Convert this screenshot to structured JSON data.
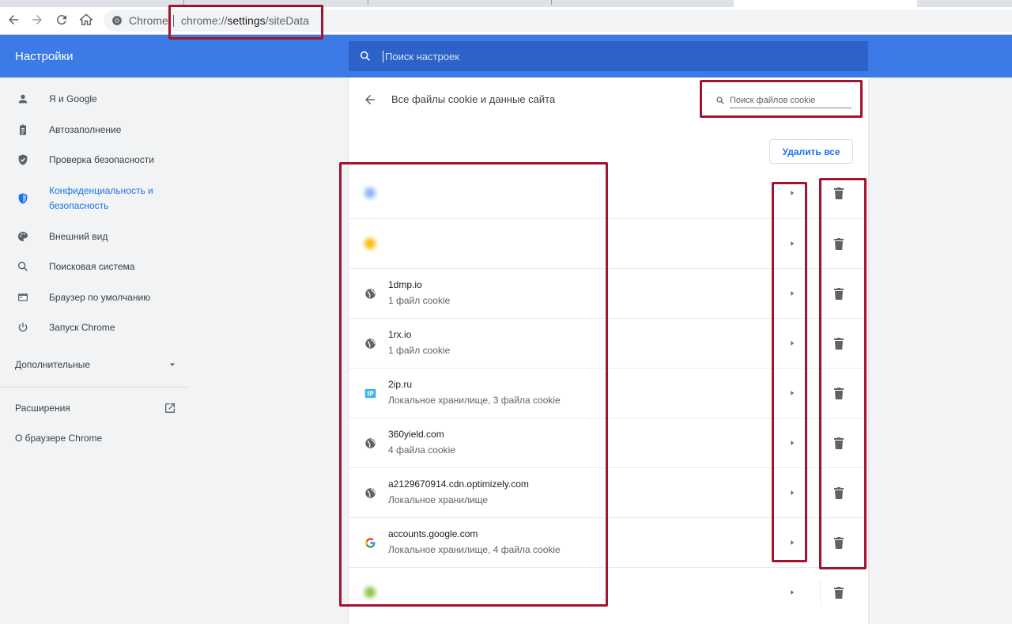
{
  "browser": {
    "chip_label": "Chrome",
    "url_prefix": "chrome://",
    "url_host": "settings",
    "url_path": "/siteData"
  },
  "header": {
    "title": "Настройки",
    "search_placeholder": "Поиск настроек"
  },
  "sidebar": {
    "items": [
      {
        "label": "Я и Google",
        "icon": "person-icon"
      },
      {
        "label": "Автозаполнение",
        "icon": "clipboard-icon"
      },
      {
        "label": "Проверка безопасности",
        "icon": "shield-check-icon"
      },
      {
        "label": "Конфиденциальность и безопасность",
        "label_line1": "Конфиденциальность и",
        "label_line2": "безопасность",
        "icon": "privacy-shield-icon",
        "active": true
      },
      {
        "label": "Внешний вид",
        "icon": "palette-icon"
      },
      {
        "label": "Поисковая система",
        "icon": "search-icon"
      },
      {
        "label": "Браузер по умолчанию",
        "icon": "browser-window-icon"
      },
      {
        "label": "Запуск Chrome",
        "icon": "power-icon"
      }
    ],
    "advanced": "Дополнительные",
    "extensions": "Расширения",
    "about": "О браузере Chrome"
  },
  "page": {
    "title": "Все файлы cookie и данные сайта",
    "cookie_search_placeholder": "Поиск файлов cookie",
    "delete_all": "Удалить все"
  },
  "sites": [
    {
      "name": "",
      "desc": "",
      "favicon": "blurred-favicon",
      "blurred": true
    },
    {
      "name": "",
      "desc": "",
      "favicon": "blurred-favicon",
      "blurred": true
    },
    {
      "name": "1dmp.io",
      "desc": "1 файл cookie",
      "favicon": "globe-icon"
    },
    {
      "name": "1rx.io",
      "desc": "1 файл cookie",
      "favicon": "globe-icon"
    },
    {
      "name": "2ip.ru",
      "desc": "Локальное хранилище, 3 файла cookie",
      "favicon": "ip-favicon"
    },
    {
      "name": "360yield.com",
      "desc": "4 файла cookie",
      "favicon": "globe-icon"
    },
    {
      "name": "a2129670914.cdn.optimizely.com",
      "desc": "Локальное хранилище",
      "favicon": "globe-icon"
    },
    {
      "name": "accounts.google.com",
      "desc": "Локальное хранилище, 4 файла cookie",
      "favicon": "google-icon"
    },
    {
      "name": "",
      "desc": "",
      "favicon": "blurred-favicon",
      "blurred": true
    }
  ],
  "colors": {
    "header_blue": "#3c7be6",
    "search_blue": "#2d63c8",
    "accent": "#1a73e8",
    "annotation_red": "#a2132f"
  }
}
